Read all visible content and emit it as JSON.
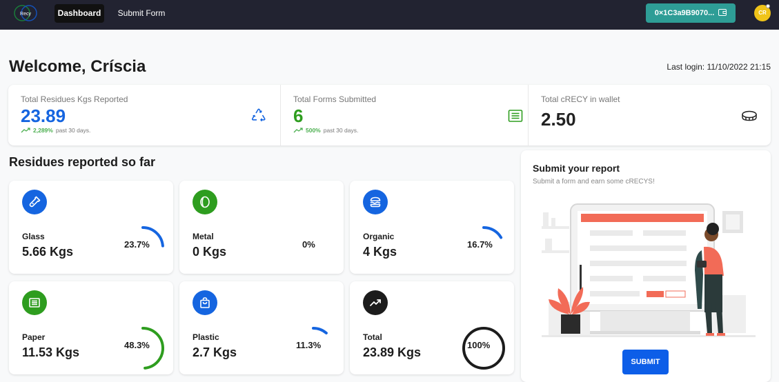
{
  "topbar": {
    "logo_text": "Recy",
    "nav": {
      "dashboard": "Dashboard",
      "submit_form": "Submit Form"
    },
    "wallet_address": "0×1C3a9B9070...",
    "avatar_initials": "CR"
  },
  "header": {
    "welcome": "Welcome, Críscia",
    "last_login": "Last login: 11/10/2022 21:15"
  },
  "stats": {
    "residues": {
      "title": "Total Residues Kgs Reported",
      "value": "23.89",
      "trend_pct": "2,289%",
      "trend_text": "past 30 days.",
      "icon": "recycle-icon"
    },
    "forms": {
      "title": "Total Forms Submitted",
      "value": "6",
      "trend_pct": "500%",
      "trend_text": "past 30 days.",
      "icon": "form-list-icon"
    },
    "wallet": {
      "title": "Total cRECY in wallet",
      "value": "2.50",
      "icon": "coin-icon"
    }
  },
  "residues": {
    "title": "Residues reported so far",
    "items": [
      {
        "name": "Glass",
        "value": "5.66 Kgs",
        "pct_label": "23.7%",
        "fraction": 0.237,
        "color": "#1565e0",
        "icon": "bottle-icon"
      },
      {
        "name": "Metal",
        "value": "0 Kgs",
        "pct_label": "0%",
        "fraction": 0,
        "color": "#2e9d1f",
        "icon": "can-icon"
      },
      {
        "name": "Organic",
        "value": "4 Kgs",
        "pct_label": "16.7%",
        "fraction": 0.167,
        "color": "#1565e0",
        "icon": "burger-icon"
      },
      {
        "name": "Paper",
        "value": "11.53 Kgs",
        "pct_label": "48.3%",
        "fraction": 0.483,
        "color": "#2e9d1f",
        "icon": "newspaper-icon"
      },
      {
        "name": "Plastic",
        "value": "2.7 Kgs",
        "pct_label": "11.3%",
        "fraction": 0.113,
        "color": "#1565e0",
        "icon": "bag-icon"
      },
      {
        "name": "Total",
        "value": "23.89 Kgs",
        "pct_label": "100%",
        "fraction": 1,
        "color": "#1c1c1c",
        "icon": "trend-up-icon"
      }
    ]
  },
  "report": {
    "title": "Submit your report",
    "subtitle": "Submit a form and earn some cRECYS!",
    "button": "SUBMIT"
  },
  "colors": {
    "topbar": "#222331",
    "wallet_button": "#2e9d96",
    "accent_blue": "#1565e0",
    "accent_green": "#2e9d1f",
    "submit": "#0d5ee8"
  }
}
